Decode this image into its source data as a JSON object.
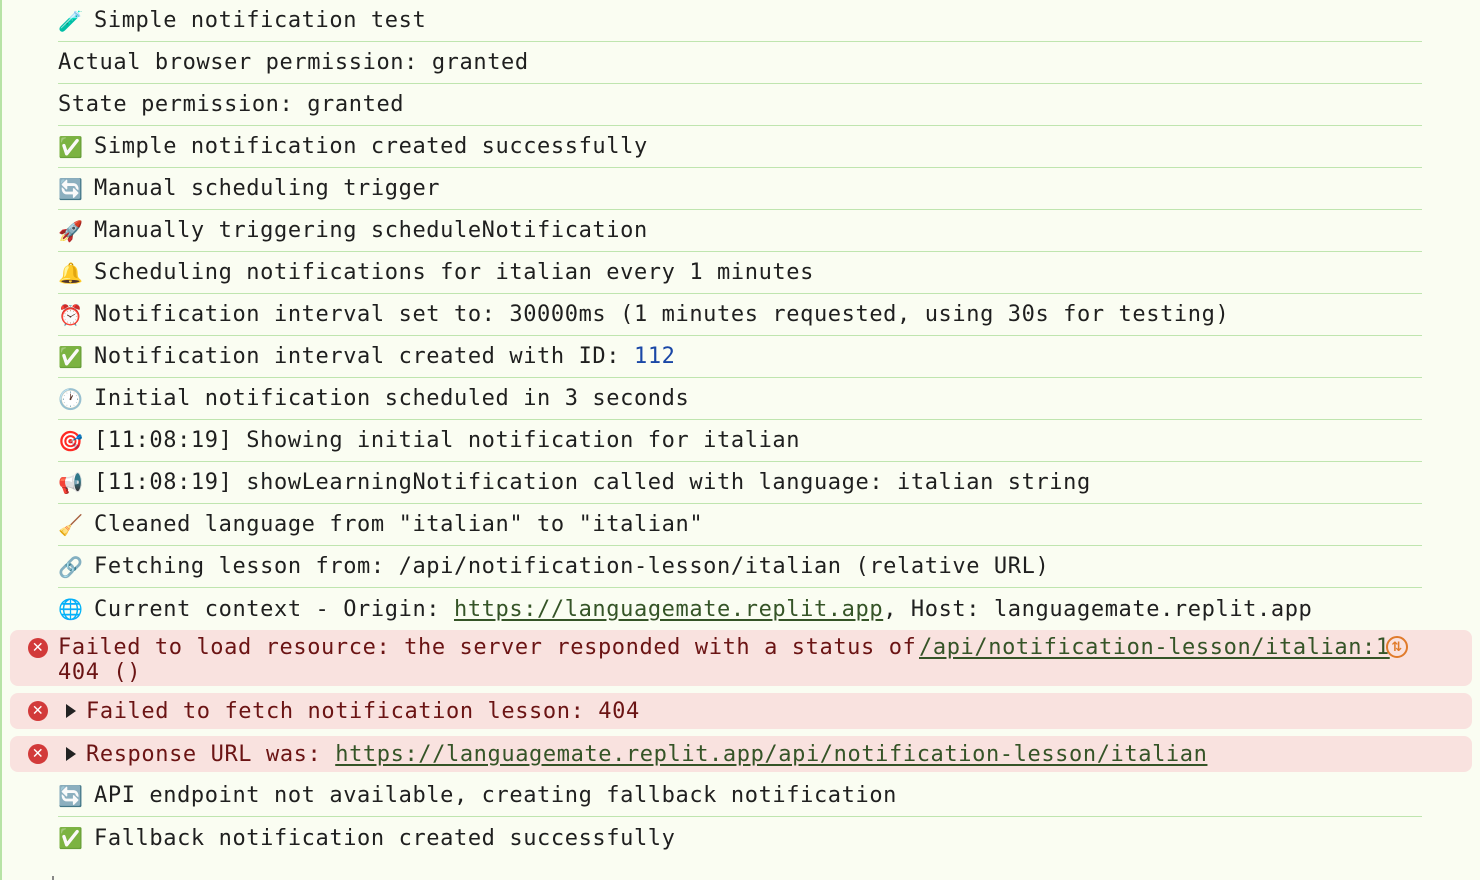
{
  "logs": [
    {
      "icon": "🧪",
      "icon_name": "test-tube-icon",
      "text": "Simple notification test"
    },
    {
      "icon": "",
      "icon_name": "",
      "text": "Actual browser permission: granted"
    },
    {
      "icon": "",
      "icon_name": "",
      "text": "State permission: granted"
    },
    {
      "icon": "✅",
      "icon_name": "check-mark-icon",
      "text": "Simple notification created successfully"
    },
    {
      "icon": "🔄",
      "icon_name": "refresh-icon",
      "text": "Manual scheduling trigger"
    },
    {
      "icon": "🚀",
      "icon_name": "rocket-icon",
      "text": "Manually triggering scheduleNotification"
    },
    {
      "icon": "🔔",
      "icon_name": "bell-icon",
      "text": "Scheduling notifications for italian every 1 minutes"
    },
    {
      "icon": "⏰",
      "icon_name": "alarm-clock-icon",
      "text": "Notification interval set to: 30000ms (1 minutes requested, using 30s for testing)"
    },
    {
      "icon": "✅",
      "icon_name": "check-mark-icon",
      "text": "Notification interval created with ID: ",
      "value": "112"
    },
    {
      "icon": "🕐",
      "icon_name": "timer-icon",
      "text": "Initial notification scheduled in 3 seconds"
    },
    {
      "icon": "🎯",
      "icon_name": "target-icon",
      "text": "[11:08:19] Showing initial notification for italian"
    },
    {
      "icon": "📢",
      "icon_name": "megaphone-icon",
      "text": "[11:08:19] showLearningNotification called with language: italian string"
    },
    {
      "icon": "🧹",
      "icon_name": "broom-icon",
      "text": "Cleaned language from \"italian\" to \"italian\""
    },
    {
      "icon": "🔗",
      "icon_name": "link-icon",
      "text": "Fetching lesson from: /api/notification-lesson/italian (relative URL)"
    },
    {
      "icon": "🌐",
      "icon_name": "globe-icon",
      "text_before": "Current context - Origin: ",
      "link": "https://languagemate.replit.app",
      "text_after": ", Host: languagemate.replit.app"
    }
  ],
  "errors": [
    {
      "text": "Failed to load resource: the server responded with a status of 404 ()",
      "source": "/api/notification-lesson/italian:1"
    },
    {
      "text": "Failed to fetch notification lesson: 404"
    },
    {
      "text": "Response URL was: ",
      "link": "https://languagemate.replit.app/api/notification-lesson/italian"
    }
  ],
  "after": [
    {
      "icon": "🔄",
      "icon_name": "refresh-icon",
      "text": "API endpoint not available, creating fallback notification"
    },
    {
      "icon": "✅",
      "icon_name": "check-mark-icon",
      "text": "Fallback notification created successfully"
    }
  ],
  "colors": {
    "background": "#fafdf2",
    "row_border": "#bfe5af",
    "error_background": "#f9e2df",
    "error_text": "#6b1414",
    "error_icon": "#d23a3a",
    "number": "#1a47a6"
  }
}
